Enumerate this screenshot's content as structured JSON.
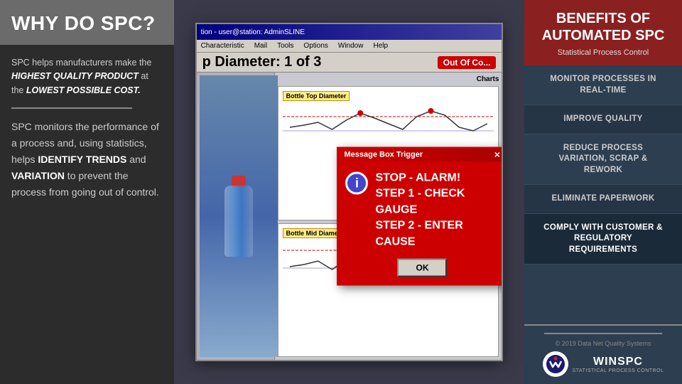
{
  "left": {
    "title": "WHY DO SPC?",
    "desc_part1": "SPC helps manufacturers make the ",
    "desc_bold1": "HIGHEST QUALITY PRODUCT",
    "desc_part2": " at the ",
    "desc_bold2": "LOWEST POSSIBLE COST.",
    "monitors_intro": "SPC monitors the performance of a process and, using statistics, helps ",
    "identify_trends": "IDENTIFY TRENDS",
    "and_text": " and ",
    "variation": "VARIATION",
    "monitors_end": " to prevent the process from going out of control."
  },
  "software": {
    "titlebar": "tion - user@station: AdminSLINE",
    "menubar_items": [
      "Characteristic",
      "Mail",
      "Tools",
      "Options",
      "Window",
      "Help"
    ],
    "diameter_label": "p Diameter: 1 of 3",
    "out_of_control": "Out Of Co...",
    "charts_label": "Charts",
    "alarm_title": "Message Box Trigger",
    "alarm_line1": "STOP - ALARM!",
    "alarm_line2": "STEP 1 - CHECK GAUGE",
    "alarm_line3": "STEP 2 - ENTER CAUSE",
    "ok_label": "OK",
    "bottle_top_label": "Bottle Top Diameter",
    "bottle_mid_label": "Bottle Mid Diameter"
  },
  "right": {
    "benefits_title": "BENEFITS OF\nAUTOMATED SPC",
    "subtitle": "Statistical Process Control",
    "benefits": [
      "MONITOR PROCESSES IN\nREAL-TIME",
      "IMPROVE QUALITY",
      "REDUCE PROCESS\nVARIATION, SCRAP &\nREWORK",
      "ELIMINATE PAPERWORK",
      "COMPLY WITH CUSTOMER &\nREGULATORY\nREQUIREMENTS"
    ],
    "copyright": "© 2019 Data Net Quality Systems",
    "logo_name": "WINSPC",
    "logo_subtitle": "STATISTICAL PROCESS CONTROL"
  }
}
